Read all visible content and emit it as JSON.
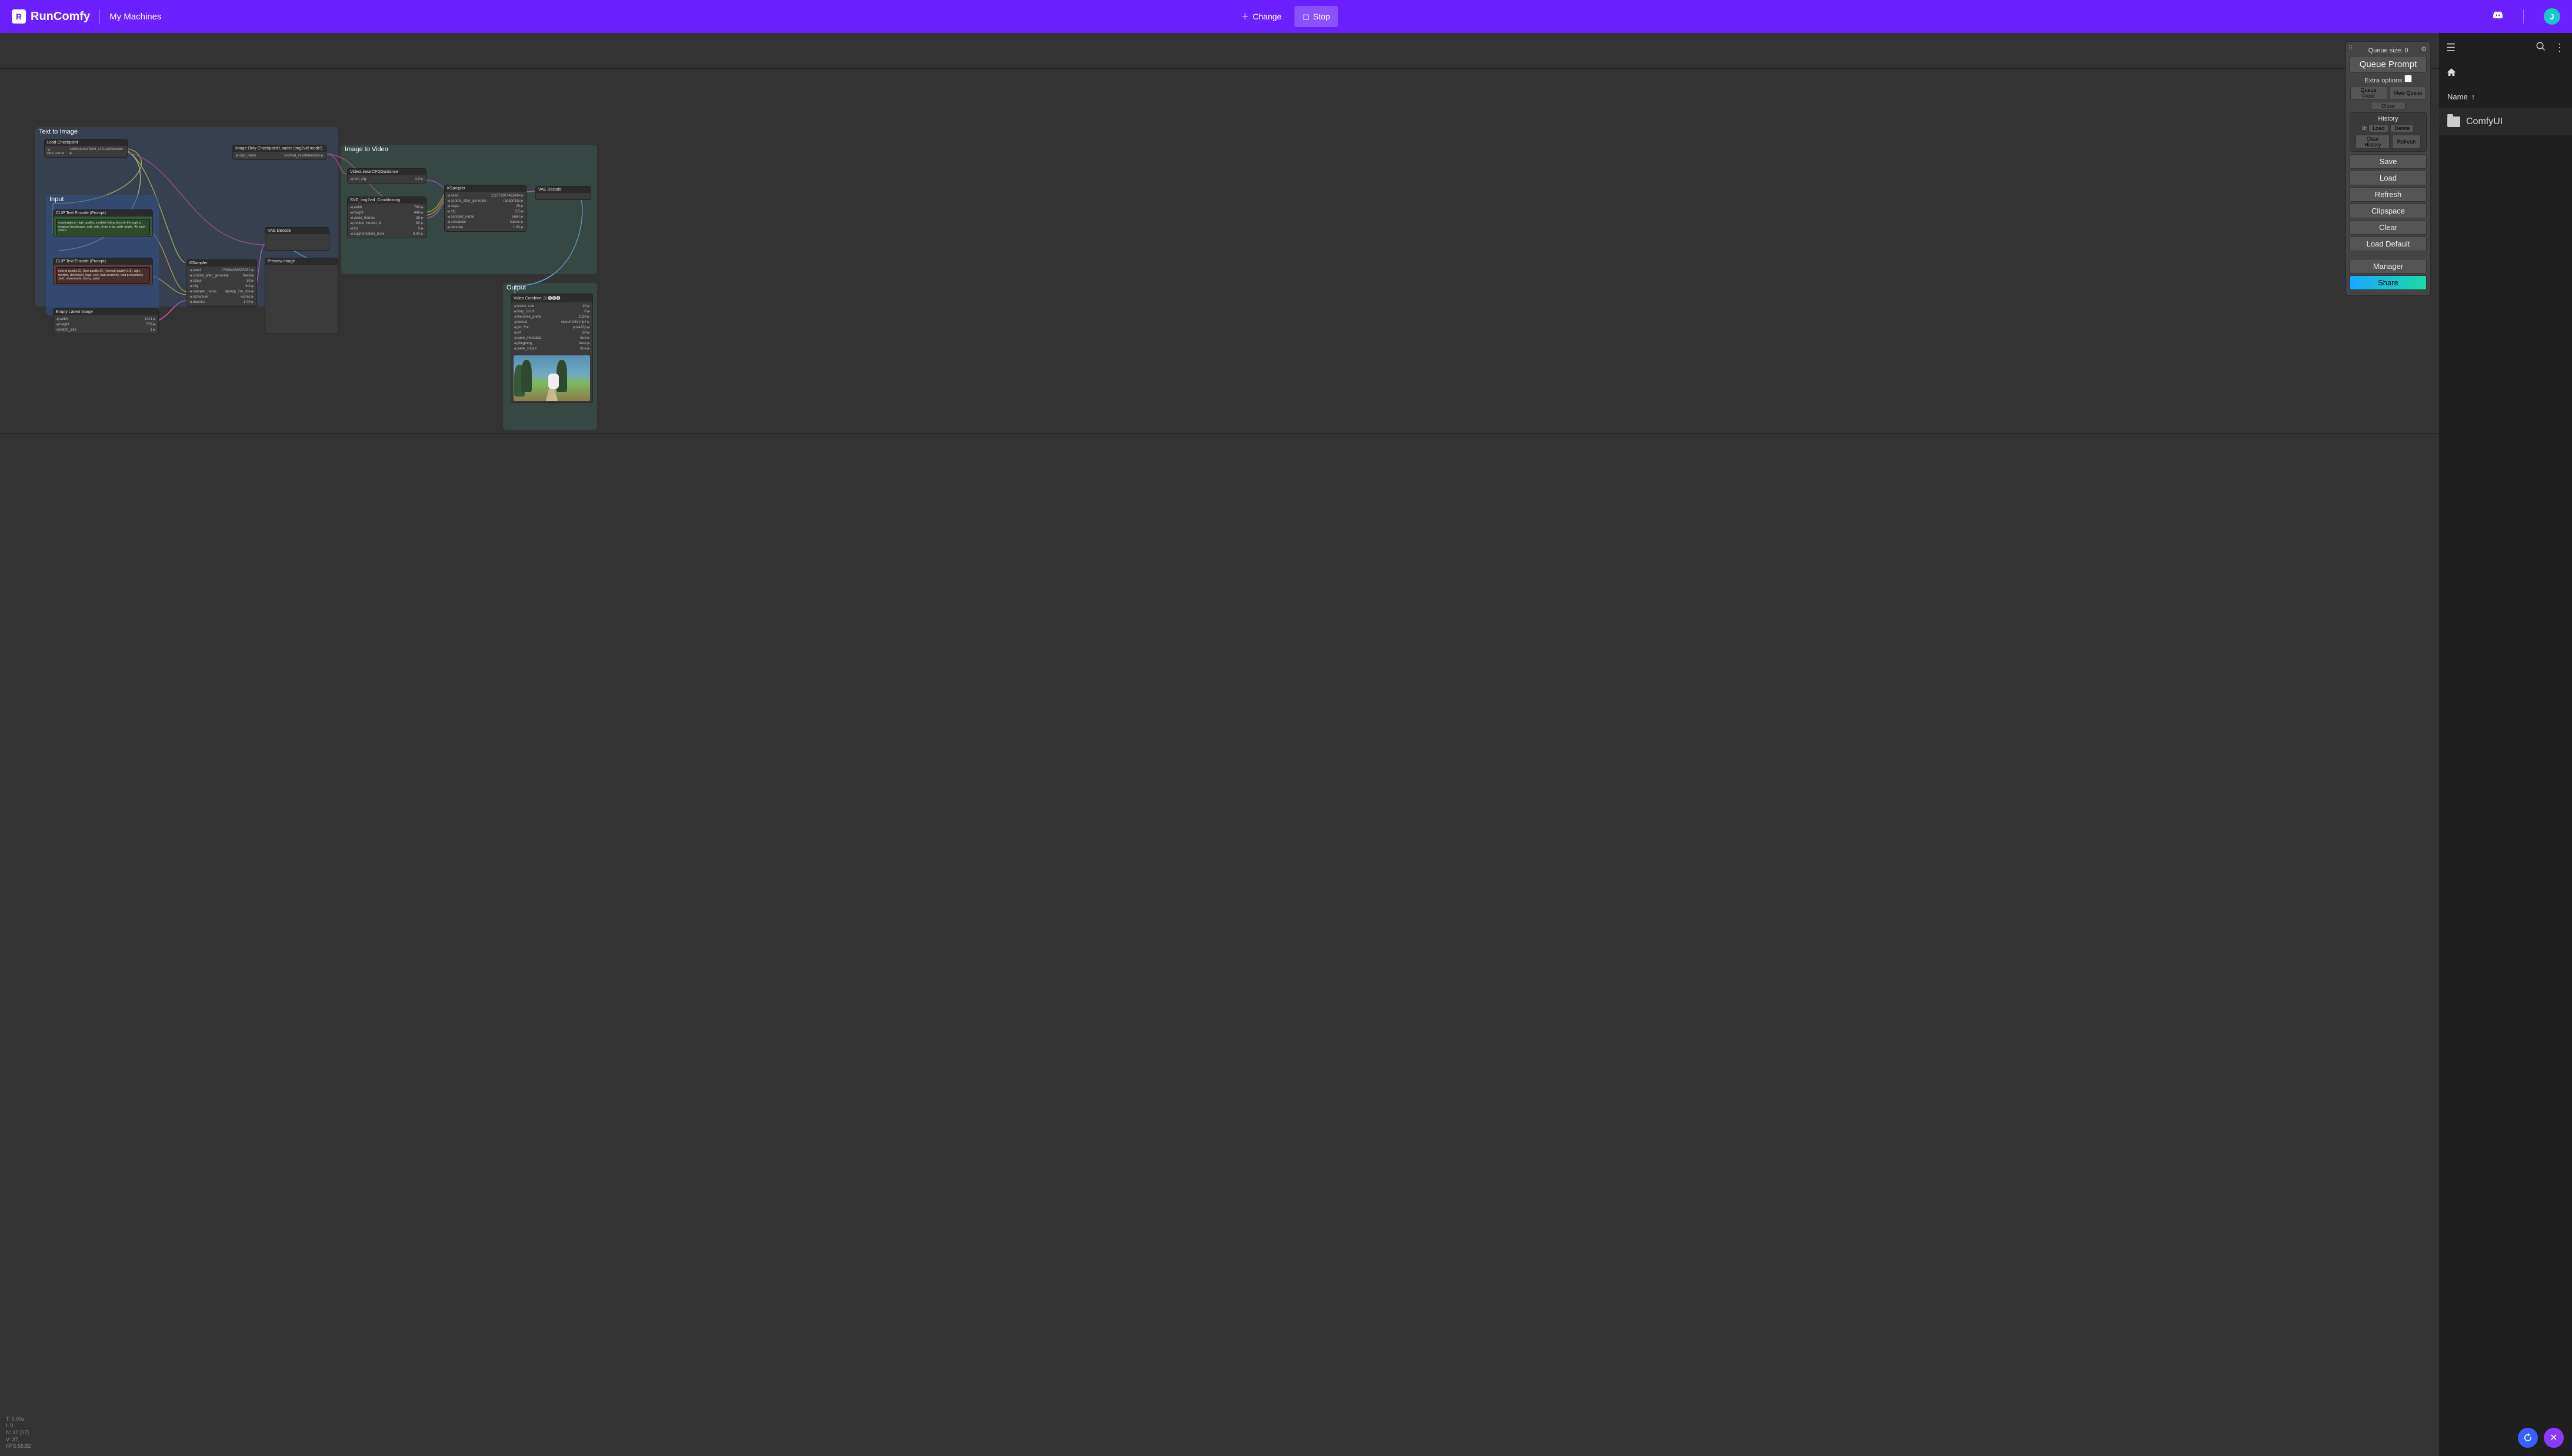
{
  "topbar": {
    "brand": "RunComfy",
    "my_machines": "My Machines",
    "change": "Change",
    "stop": "Stop",
    "avatar_initial": "J"
  },
  "stats": {
    "t": "T: 0.00s",
    "i": "I: 0",
    "n": "N: 17 [17]",
    "v": "V: 37",
    "fps": "FPS:56.82"
  },
  "groups": {
    "text_to_image": "Text to Image",
    "image_to_video": "Image to Video",
    "output": "Output",
    "input": "Input"
  },
  "nodes": {
    "load_ckpt": {
      "title": "Load Checkpoint",
      "rows": [
        [
          "ckpt_name",
          "sdxl/counterfeitxl_v10.safetensors"
        ]
      ]
    },
    "img_ckpt": {
      "title": "Image Only Checkpoint Loader (img2vid model)",
      "rows": [
        [
          "ckpt_name",
          "svd/svd_xt.safetensors"
        ]
      ]
    },
    "cfg_guidance": {
      "title": "VideoLinearCFGGuidance",
      "rows": [
        [
          "min_cfg",
          "1.0"
        ]
      ]
    },
    "svd_cond": {
      "title": "SVD_img2vid_Conditioning",
      "rows": [
        [
          "width",
          "768"
        ],
        [
          "height",
          "448"
        ],
        [
          "video_frames",
          "25"
        ],
        [
          "motion_bucket_id",
          "80"
        ],
        [
          "fps",
          "6"
        ],
        [
          "augmentation_level",
          "0.00"
        ]
      ]
    },
    "ksampler2": {
      "title": "KSampler",
      "rows": [
        [
          "seed",
          "111373307453434"
        ],
        [
          "control_after_generate",
          "randomize"
        ],
        [
          "steps",
          "25"
        ],
        [
          "cfg",
          "3.5"
        ],
        [
          "sampler_name",
          "euler"
        ],
        [
          "scheduler",
          "karras"
        ],
        [
          "denoise",
          "1.00"
        ]
      ]
    },
    "vae_decode2": {
      "title": "VAE Decode"
    },
    "clip_pos": {
      "title": "CLIP Text Encode (Prompt)",
      "text": "masterpiece, high quality, a rabbit riding bicycle through a magical landscape, suit, solo, from a far, wide angle, 4k, tack sharp"
    },
    "clip_neg": {
      "title": "CLIP Text Encode (Prompt)",
      "text": "(worst quality:2), (low quality:2), (normal quality:1.8), ugly, morbid, deformed, logo, text, bad anatomy, bad proportions ,text, watermark, blurry, paint"
    },
    "empty_latent": {
      "title": "Empty Latent Image",
      "rows": [
        [
          "width",
          "1024"
        ],
        [
          "height",
          "576"
        ],
        [
          "batch_size",
          "1"
        ]
      ]
    },
    "ksampler1": {
      "title": "KSampler",
      "rows": [
        [
          "seed",
          "170684038525081"
        ],
        [
          "control_after_generate",
          "fixed"
        ],
        [
          "steps",
          "30"
        ],
        [
          "cfg",
          "8.0"
        ],
        [
          "sampler_name",
          "dpmpp_2m_sde"
        ],
        [
          "scheduler",
          "karras"
        ],
        [
          "denoise",
          "1.00"
        ]
      ]
    },
    "vae_decode1": {
      "title": "VAE Decode"
    },
    "preview": {
      "title": "Preview Image"
    },
    "video_combine": {
      "title": "Video Combine 🎥🅥🅗🅢",
      "rows": [
        [
          "frame_rate",
          "10"
        ],
        [
          "loop_count",
          "0"
        ],
        [
          "filename_prefix",
          "1020"
        ],
        [
          "format",
          "video/h264-mp4"
        ],
        [
          "pix_fmt",
          "yuv420p"
        ],
        [
          "crf",
          "20"
        ],
        [
          "save_metadata",
          "true"
        ],
        [
          "pingpong",
          "false"
        ],
        [
          "save_output",
          "true"
        ]
      ]
    }
  },
  "panel": {
    "queue_size": "Queue size: 0",
    "queue_prompt": "Queue Prompt",
    "extra_options": "Extra options",
    "queue_front": "Queue Front",
    "view_queue": "View Queue",
    "close": "Close",
    "history": "History",
    "history_idx": "0:",
    "load_mini": "Load",
    "delete_mini": "Delete",
    "clear_history": "Clear History",
    "refresh_mini": "Refresh",
    "save": "Save",
    "load": "Load",
    "refresh": "Refresh",
    "clipspace": "Clipspace",
    "clear": "Clear",
    "load_default": "Load Default",
    "manager": "Manager",
    "share": "Share"
  },
  "sidebar": {
    "name_header": "Name",
    "folder": "ComfyUI"
  }
}
